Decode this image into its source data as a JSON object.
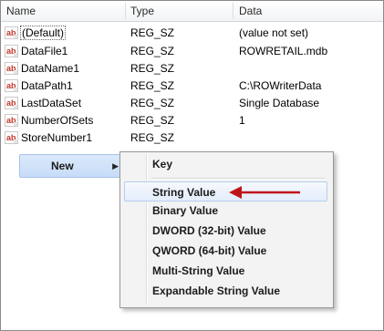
{
  "columns": {
    "name": "Name",
    "type": "Type",
    "data": "Data"
  },
  "icon_label": "ab",
  "rows": [
    {
      "name": "(Default)",
      "type": "REG_SZ",
      "data": "(value not set)"
    },
    {
      "name": "DataFile1",
      "type": "REG_SZ",
      "data": "ROWRETAIL.mdb"
    },
    {
      "name": "DataName1",
      "type": "REG_SZ",
      "data": ""
    },
    {
      "name": "DataPath1",
      "type": "REG_SZ",
      "data": "C:\\ROWriterData"
    },
    {
      "name": "LastDataSet",
      "type": "REG_SZ",
      "data": "Single Database"
    },
    {
      "name": "NumberOfSets",
      "type": "REG_SZ",
      "data": "1"
    },
    {
      "name": "StoreNumber1",
      "type": "REG_SZ",
      "data": ""
    }
  ],
  "context_menu": {
    "new_label": "New",
    "submenu_arrow": "▶"
  },
  "submenu": {
    "items": [
      {
        "label": "Key"
      },
      {
        "label": "String Value"
      },
      {
        "label": "Binary Value"
      },
      {
        "label": "DWORD (32-bit) Value"
      },
      {
        "label": "QWORD (64-bit) Value"
      },
      {
        "label": "Multi-String Value"
      },
      {
        "label": "Expandable String Value"
      }
    ],
    "highlighted": "String Value"
  },
  "colors": {
    "annotation_arrow": "#c0141b",
    "icon_text": "#c0392b"
  },
  "icons": [
    "string-value-icon",
    "submenu-arrow-icon",
    "annotation-arrow-icon"
  ]
}
